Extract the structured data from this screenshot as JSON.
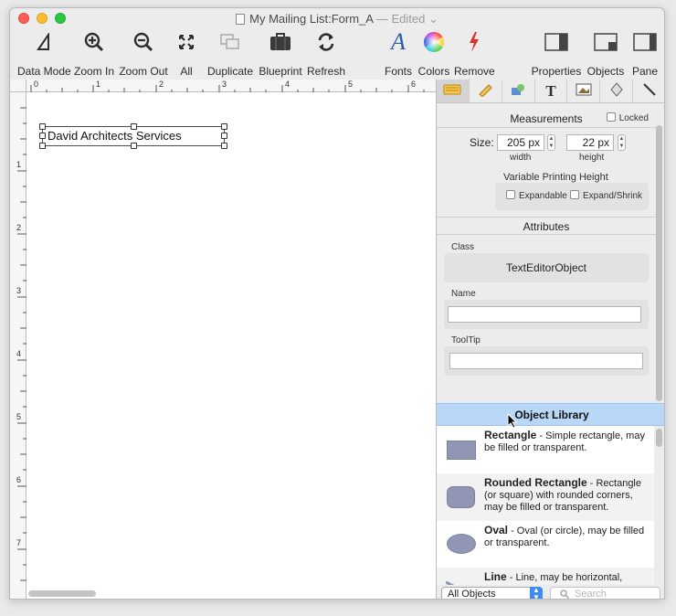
{
  "window": {
    "title": "My Mailing List:Form_A",
    "status": "— Edited ⌄"
  },
  "toolbar": {
    "left": [
      {
        "label": "Data Mode",
        "icon": "data-mode-icon",
        "glyph": "◭"
      },
      {
        "label": "Zoom In",
        "icon": "zoom-in-icon",
        "glyph": "⊕"
      },
      {
        "label": "Zoom Out",
        "icon": "zoom-out-icon",
        "glyph": "⊖"
      },
      {
        "label": "All",
        "icon": "expand-all-icon",
        "glyph": "✥"
      },
      {
        "label": "Duplicate",
        "icon": "duplicate-icon",
        "glyph": "❐"
      },
      {
        "label": "Blueprint",
        "icon": "blueprint-icon",
        "glyph": "▆"
      },
      {
        "label": "Refresh",
        "icon": "refresh-icon",
        "glyph": "⟳"
      }
    ],
    "middle": [
      {
        "label": "Fonts",
        "icon": "fonts-icon",
        "glyph": "A"
      },
      {
        "label": "Colors",
        "icon": "colors-icon",
        "glyph": "●"
      },
      {
        "label": "Remove",
        "icon": "remove-icon",
        "glyph": "ϟ"
      }
    ],
    "right": [
      {
        "label": "Properties",
        "icon": "properties-icon",
        "glyph": "▣"
      },
      {
        "label": "Objects",
        "icon": "objects-icon",
        "glyph": "▣"
      },
      {
        "label": "Pane",
        "icon": "pane-icon",
        "glyph": "▣"
      }
    ]
  },
  "ruler": {
    "top_numbers": [
      "0",
      "1",
      "2",
      "3",
      "4",
      "5",
      "6"
    ],
    "left_numbers": [
      "1",
      "2",
      "3",
      "4",
      "5",
      "6",
      "7"
    ]
  },
  "canvas": {
    "text_object": "David Architects Services"
  },
  "panel": {
    "tabs": [
      "📒",
      "✎",
      "◈",
      "T",
      "▤",
      "◊",
      "╲"
    ],
    "measurements": {
      "title": "Measurements",
      "locked_label": "Locked",
      "size_label": "Size:",
      "width_value": "205 px",
      "width_label": "width",
      "height_value": "22 px",
      "height_label": "height",
      "vph_label": "Variable Printing Height",
      "expandable_label": "Expandable",
      "expand_shrink_label": "Expand/Shrink"
    },
    "attributes": {
      "title": "Attributes",
      "class_label": "Class",
      "class_value": "TextEditorObject",
      "name_label": "Name",
      "name_value": "",
      "tooltip_label": "ToolTip",
      "tooltip_value": ""
    },
    "library": {
      "title": "Object Library",
      "items": [
        {
          "name": "Rectangle",
          "desc": " - Simple rectangle, may be filled or transparent."
        },
        {
          "name": "Rounded Rectangle",
          "desc": " - Rectangle (or square) with rounded corners, may be filled or transparent."
        },
        {
          "name": "Oval",
          "desc": " - Oval (or circle), may be filled or transparent."
        },
        {
          "name": "Line",
          "desc": " - Line, may be horizontal,"
        }
      ],
      "filter_value": "All Objects",
      "search_placeholder": "Search"
    }
  }
}
